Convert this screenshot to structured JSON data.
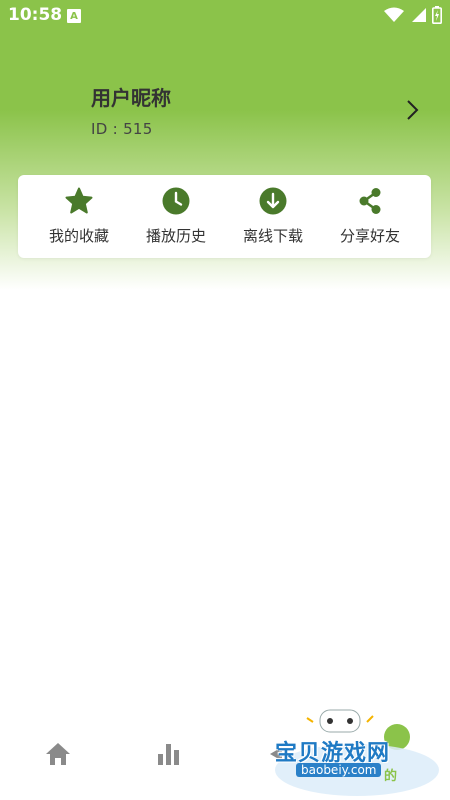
{
  "status_bar": {
    "time": "10:58",
    "notification_icon": "A"
  },
  "profile": {
    "nickname": "用户昵称",
    "id_text": "ID : 515"
  },
  "quick_actions": [
    {
      "label": "我的收藏",
      "icon": "star-icon"
    },
    {
      "label": "播放历史",
      "icon": "clock-icon"
    },
    {
      "label": "离线下载",
      "icon": "download-icon"
    },
    {
      "label": "分享好友",
      "icon": "share-icon"
    }
  ],
  "bottom_nav": [
    {
      "icon": "home-icon"
    },
    {
      "icon": "bar-chart-icon"
    },
    {
      "icon": "back-icon"
    },
    {
      "icon": "profile-tab-icon"
    }
  ],
  "watermark": {
    "title": "宝贝游戏网",
    "url": "baobeiy.com",
    "tail": "的"
  },
  "colors": {
    "accent": "#8bc34a",
    "icon_green": "#4a7a2b",
    "nav_gray": "#8a8a8a"
  }
}
